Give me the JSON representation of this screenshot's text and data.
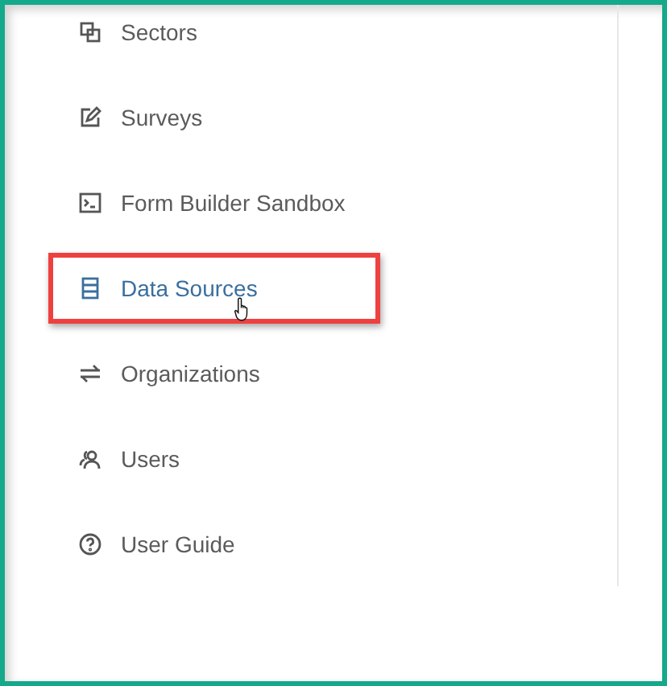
{
  "sidebar": {
    "items": [
      {
        "label": "Sectors",
        "selected": false,
        "highlighted": false,
        "hovered": false
      },
      {
        "label": "Surveys",
        "selected": false,
        "highlighted": false,
        "hovered": false
      },
      {
        "label": "Form Builder Sandbox",
        "selected": false,
        "highlighted": false,
        "hovered": false
      },
      {
        "label": "Data Sources",
        "selected": true,
        "highlighted": true,
        "hovered": true
      },
      {
        "label": "Organizations",
        "selected": false,
        "highlighted": false,
        "hovered": false
      },
      {
        "label": "Users",
        "selected": false,
        "highlighted": false,
        "hovered": false
      },
      {
        "label": "User Guide",
        "selected": false,
        "highlighted": false,
        "hovered": false
      }
    ]
  }
}
